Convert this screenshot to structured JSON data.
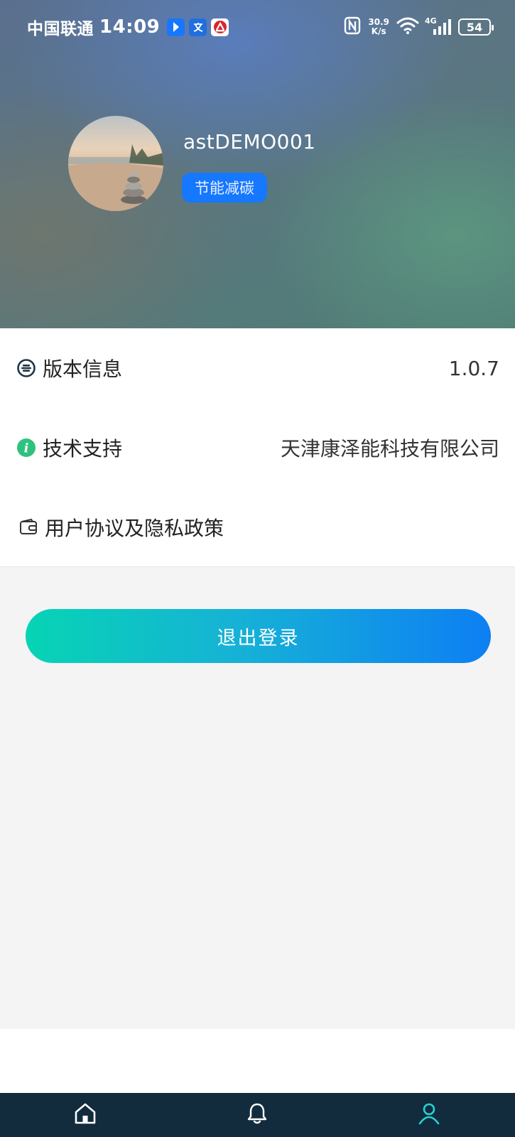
{
  "status_bar": {
    "carrier": "中国联通",
    "time": "14:09",
    "app_icons": [
      "blue-arrow-app-icon",
      "translate-app-icon",
      "bank-app-icon"
    ],
    "net_speed_value": "30.9",
    "net_speed_unit": "K/s",
    "network_type": "4G",
    "battery": "54"
  },
  "profile": {
    "username": "astDEMO001",
    "role_tag": "节能减碳"
  },
  "settings": [
    {
      "icon": "version-icon",
      "label": "版本信息",
      "value": "1.0.7"
    },
    {
      "icon": "info-icon",
      "label": "技术支持",
      "value": "天津康泽能科技有限公司"
    },
    {
      "icon": "wallet-icon",
      "label": "用户协议及隐私政策",
      "value": ""
    }
  ],
  "logout_label": "退出登录",
  "tabbar": {
    "tabs": [
      {
        "name": "home",
        "icon": "home-icon",
        "active": false
      },
      {
        "name": "notifications",
        "icon": "bell-icon",
        "active": false
      },
      {
        "name": "profile",
        "icon": "user-icon",
        "active": true
      }
    ],
    "active_color": "#25d3d3",
    "inactive_color": "#ffffff"
  },
  "colors": {
    "tag_blue": "#1677ff",
    "button_gradient_start": "#07d4b4",
    "button_gradient_end": "#0d7ff3",
    "tabbar_bg": "#122c3e"
  }
}
